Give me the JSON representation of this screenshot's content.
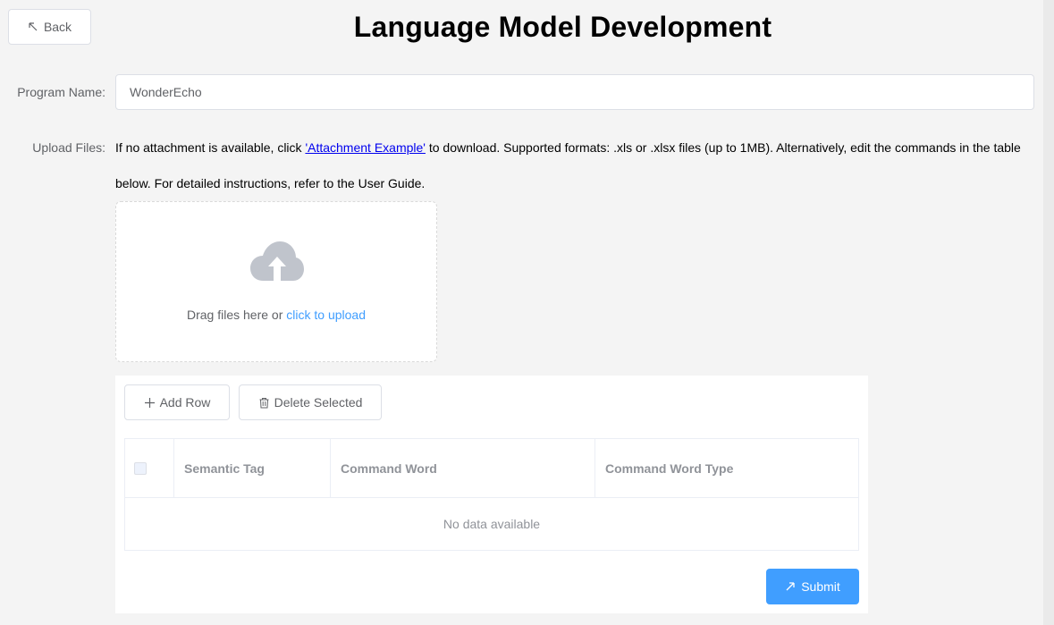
{
  "header": {
    "back_label": "Back",
    "title": "Language Model Development"
  },
  "form": {
    "program_name_label": "Program Name:",
    "program_name_value": "WonderEcho",
    "upload_label": "Upload Files:",
    "instructions_before_link": "If no attachment is available, click ",
    "instructions_link": "'Attachment Example'",
    "instructions_after_link": " to download. Supported formats: .xls or .xlsx files (up to 1MB). Alternatively, edit the commands in the table below. For detailed instructions, refer to the User Guide."
  },
  "upload": {
    "icon": "upload-cloud-icon",
    "prompt_text": "Drag files here or ",
    "prompt_link": "click to upload"
  },
  "table": {
    "add_row_label": "Add Row",
    "delete_selected_label": "Delete Selected",
    "columns": [
      "Semantic Tag",
      "Command Word",
      "Command Word Type"
    ],
    "rows": [],
    "empty_text": "No data available"
  },
  "actions": {
    "submit_label": "Submit"
  },
  "colors": {
    "accent": "#409eff",
    "link": "#0000ee",
    "background": "#f4f4f4"
  }
}
